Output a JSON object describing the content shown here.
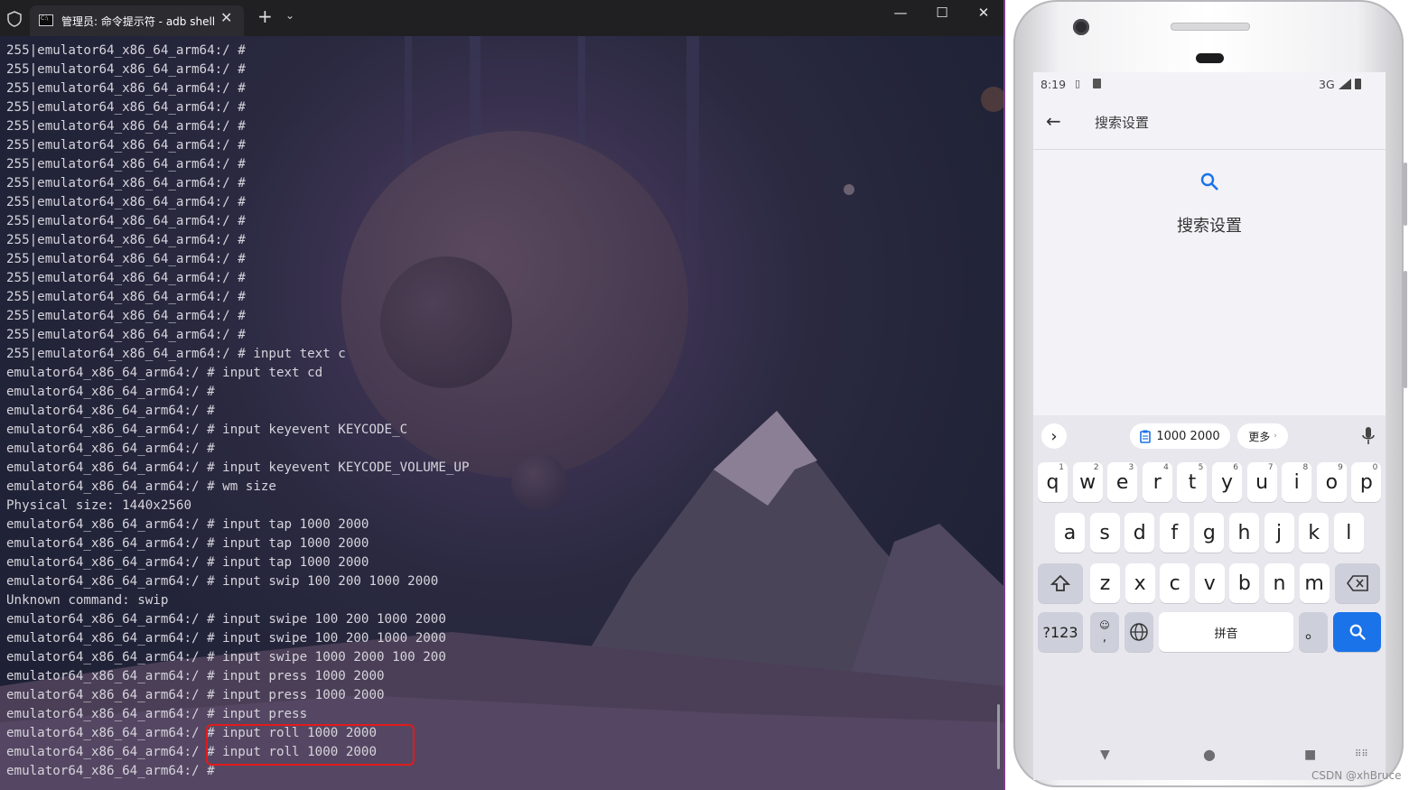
{
  "terminal": {
    "tab_title": "管理员: 命令提示符 - adb  shell",
    "close_tab": "✕",
    "new_tab": "+",
    "dropdown": "⌄",
    "window_controls": {
      "minimize": "—",
      "maximize": "☐",
      "close": "✕"
    },
    "lines": [
      "255|emulator64_x86_64_arm64:/ #",
      "255|emulator64_x86_64_arm64:/ #",
      "255|emulator64_x86_64_arm64:/ #",
      "255|emulator64_x86_64_arm64:/ #",
      "255|emulator64_x86_64_arm64:/ #",
      "255|emulator64_x86_64_arm64:/ #",
      "255|emulator64_x86_64_arm64:/ #",
      "255|emulator64_x86_64_arm64:/ #",
      "255|emulator64_x86_64_arm64:/ #",
      "255|emulator64_x86_64_arm64:/ #",
      "255|emulator64_x86_64_arm64:/ #",
      "255|emulator64_x86_64_arm64:/ #",
      "255|emulator64_x86_64_arm64:/ #",
      "255|emulator64_x86_64_arm64:/ #",
      "255|emulator64_x86_64_arm64:/ #",
      "255|emulator64_x86_64_arm64:/ #",
      "255|emulator64_x86_64_arm64:/ # input text c",
      "emulator64_x86_64_arm64:/ # input text cd",
      "emulator64_x86_64_arm64:/ #",
      "emulator64_x86_64_arm64:/ #",
      "emulator64_x86_64_arm64:/ # input keyevent KEYCODE_C",
      "emulator64_x86_64_arm64:/ #",
      "emulator64_x86_64_arm64:/ # input keyevent KEYCODE_VOLUME_UP",
      "emulator64_x86_64_arm64:/ # wm size",
      "Physical size: 1440x2560",
      "emulator64_x86_64_arm64:/ # input tap 1000 2000",
      "emulator64_x86_64_arm64:/ # input tap 1000 2000",
      "emulator64_x86_64_arm64:/ # input tap 1000 2000",
      "emulator64_x86_64_arm64:/ # input swip 100 200 1000 2000",
      "Unknown command: swip",
      "emulator64_x86_64_arm64:/ # input swipe 100 200 1000 2000",
      "emulator64_x86_64_arm64:/ # input swipe 100 200 1000 2000",
      "emulator64_x86_64_arm64:/ # input swipe 1000 2000 100 200",
      "emulator64_x86_64_arm64:/ # input press 1000 2000",
      "emulator64_x86_64_arm64:/ # input press 1000 2000",
      "emulator64_x86_64_arm64:/ # input press",
      "emulator64_x86_64_arm64:/ # input roll 1000 2000",
      "emulator64_x86_64_arm64:/ # input roll 1000 2000",
      "emulator64_x86_64_arm64:/ #"
    ]
  },
  "phone": {
    "status": {
      "time": "8:19",
      "network": "3G"
    },
    "appbar": {
      "back_icon": "arrow-left-icon",
      "title": "搜索设置"
    },
    "empty_state": {
      "icon": "search-icon",
      "title": "搜索设置"
    },
    "keyboard": {
      "suggestion_expand": "›",
      "clipboard_chip": "1000 2000",
      "more_chip": "更多",
      "row1": [
        {
          "k": "q",
          "n": "1"
        },
        {
          "k": "w",
          "n": "2"
        },
        {
          "k": "e",
          "n": "3"
        },
        {
          "k": "r",
          "n": "4"
        },
        {
          "k": "t",
          "n": "5"
        },
        {
          "k": "y",
          "n": "6"
        },
        {
          "k": "u",
          "n": "7"
        },
        {
          "k": "i",
          "n": "8"
        },
        {
          "k": "o",
          "n": "9"
        },
        {
          "k": "p",
          "n": "0"
        }
      ],
      "row2": [
        "a",
        "s",
        "d",
        "f",
        "g",
        "h",
        "j",
        "k",
        "l"
      ],
      "row3": [
        "z",
        "x",
        "c",
        "v",
        "b",
        "n",
        "m"
      ],
      "symbols_key": "?123",
      "emoji_comma": ",",
      "space_label": "拼音",
      "period": "。"
    }
  },
  "watermark": "CSDN @xhBruce"
}
